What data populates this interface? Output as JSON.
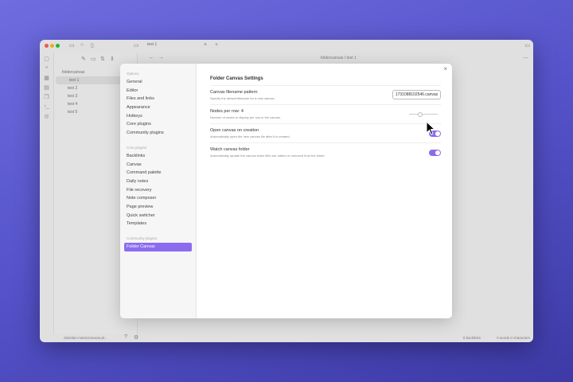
{
  "window": {
    "tab_title": "test 1",
    "breadcrumb": "foldercanvas / test 1"
  },
  "file_tree": {
    "folder": "foldercanvas",
    "files": [
      "test 1",
      "test 2",
      "test 3",
      "test 4",
      "test 5"
    ]
  },
  "status_bar": {
    "vault": "obsidian-notes2canvas-pl...",
    "right": "0 backlinks",
    "counts": "0 words 0 characters"
  },
  "settings": {
    "sections": [
      {
        "header": "Options",
        "items": [
          "General",
          "Editor",
          "Files and links",
          "Appearance",
          "Hotkeys",
          "Core plugins",
          "Community plugins"
        ]
      },
      {
        "header": "Core plugins",
        "items": [
          "Backlinks",
          "Canvas",
          "Command palette",
          "Daily notes",
          "File recovery",
          "Note composer",
          "Page preview",
          "Quick switcher",
          "Templates"
        ]
      },
      {
        "header": "Community plugins",
        "items": [
          "Folder Canvas"
        ]
      }
    ],
    "selected": "Folder Canvas",
    "title": "Folder Canvas Settings",
    "rows": [
      {
        "name": "Canvas filename pattern",
        "desc": "Specify the default filename for a new canvas.",
        "value": "1731088102546.canvas"
      },
      {
        "name": "Nodes per row: 4",
        "desc": "Number of nodes to display per row in the canvas.",
        "slider_fraction": 0.3
      },
      {
        "name": "Open canvas on creation",
        "desc": "Automatically open the new canvas file after it is created.",
        "enabled": true
      },
      {
        "name": "Watch canvas folder",
        "desc": "Automatically update the canvas when files are added or removed from the folder.",
        "enabled": true
      }
    ]
  },
  "colors": {
    "accent": "#8b6cef"
  }
}
